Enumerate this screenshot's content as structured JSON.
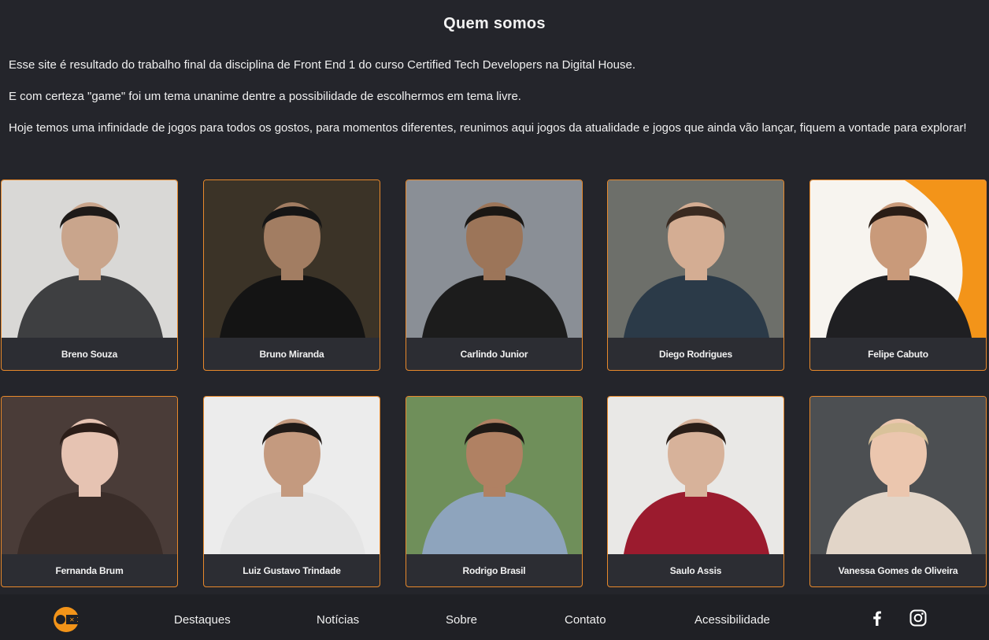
{
  "page": {
    "title": "Quem somos",
    "paragraphs": [
      "Esse site é resultado do trabalho final da disciplina de Front End 1 do curso Certified Tech Developers na Digital House.",
      "E com certeza \"game\" foi um tema unanime dentre a possibilidade de escolhermos em tema livre.",
      "Hoje temos uma infinidade de jogos para todos os gostos, para momentos diferentes, reunimos aqui jogos da atualidade e jogos que ainda vão lançar, fiquem a vontade para explorar!"
    ]
  },
  "team": [
    {
      "name": "Breno Souza",
      "bg": "#d9d8d6",
      "shirt": "#3e3f41",
      "skin": "#c9a58c",
      "hair": "#1e1a18"
    },
    {
      "name": "Bruno Miranda",
      "bg": "#3b3327",
      "shirt": "#141414",
      "skin": "#a27d62",
      "hair": "#151515"
    },
    {
      "name": "Carlindo Junior",
      "bg": "#8a8f96",
      "shirt": "#1c1c1c",
      "skin": "#9c7559",
      "hair": "#1a1714"
    },
    {
      "name": "Diego Rodrigues",
      "bg": "#6d6f6a",
      "shirt": "#2b3a48",
      "skin": "#d4ad93",
      "hair": "#3a2a20"
    },
    {
      "name": "Felipe Cabuto",
      "bg": "#f7f4ef",
      "shirt": "#1f1f22",
      "skin": "#c99a7a",
      "hair": "#2a1d16",
      "accent": "#f39419"
    },
    {
      "name": "Fernanda Brum",
      "bg": "#4a3c38",
      "shirt": "#3a2d29",
      "skin": "#e6c3b2",
      "hair": "#2b1d18"
    },
    {
      "name": "Luiz Gustavo Trindade",
      "bg": "#ececec",
      "shirt": "#e5e5e5",
      "skin": "#c49a7f",
      "hair": "#201a17"
    },
    {
      "name": "Rodrigo Brasil",
      "bg": "#6f8f5a",
      "shirt": "#8ea4bd",
      "skin": "#b08163",
      "hair": "#1e1915"
    },
    {
      "name": "Saulo Assis",
      "bg": "#e9e8e6",
      "shirt": "#9b1b2e",
      "skin": "#d7b29a",
      "hair": "#2a1e18"
    },
    {
      "name": "Vanessa Gomes de Oliveira",
      "bg": "#4c4f52",
      "shirt": "#e2d5c8",
      "skin": "#ebc6ae",
      "hair": "#d9c29a"
    }
  ],
  "footer": {
    "nav": [
      "Destaques",
      "Notícias",
      "Sobre",
      "Contato",
      "Acessibilidade"
    ],
    "icons": [
      "facebook-icon",
      "instagram-icon"
    ],
    "logo": "gamepad-logo-icon",
    "accent": "#f39419"
  },
  "colors": {
    "background": "#24252b",
    "card_border": "#e8892b",
    "footer_bg": "#1f2025"
  }
}
